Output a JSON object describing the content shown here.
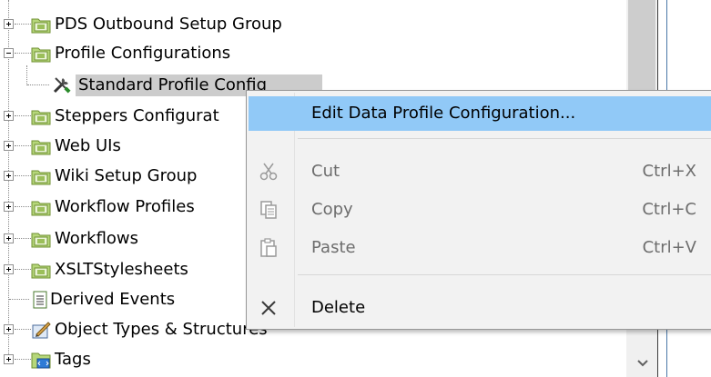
{
  "tree": {
    "items": [
      {
        "label": "PDS Outbound Setup Group",
        "icon": "folder-icon"
      },
      {
        "label": "Profile Configurations",
        "icon": "folder-icon"
      },
      {
        "label": "Standard Profile Config",
        "icon": "tools-icon"
      },
      {
        "label": "Steppers Configurat",
        "icon": "folder-icon"
      },
      {
        "label": "Web UIs",
        "icon": "folder-icon"
      },
      {
        "label": "Wiki Setup Group",
        "icon": "folder-icon"
      },
      {
        "label": "Workflow Profiles",
        "icon": "folder-icon"
      },
      {
        "label": "Workflows",
        "icon": "folder-icon"
      },
      {
        "label": "XSLTStylesheets",
        "icon": "folder-icon"
      },
      {
        "label": "Derived Events",
        "icon": "document-icon"
      },
      {
        "label": "Object Types & Structures",
        "icon": "object-types-icon"
      },
      {
        "label": "Tags",
        "icon": "tags-icon"
      }
    ]
  },
  "context_menu": {
    "items": [
      {
        "label": "Edit Data Profile Configuration...",
        "shortcut": "",
        "enabled": true
      },
      {
        "label": "Cut",
        "shortcut": "Ctrl+X",
        "enabled": false,
        "icon": "scissors-icon"
      },
      {
        "label": "Copy",
        "shortcut": "Ctrl+C",
        "enabled": false,
        "icon": "copy-icon"
      },
      {
        "label": "Paste",
        "shortcut": "Ctrl+V",
        "enabled": false,
        "icon": "paste-icon"
      },
      {
        "label": "Delete",
        "shortcut": "",
        "enabled": true,
        "icon": "delete-icon"
      }
    ]
  },
  "colors": {
    "menu_highlight": "#91c9f7",
    "selection": "#cccccc",
    "folder": "#9bbf5a"
  }
}
